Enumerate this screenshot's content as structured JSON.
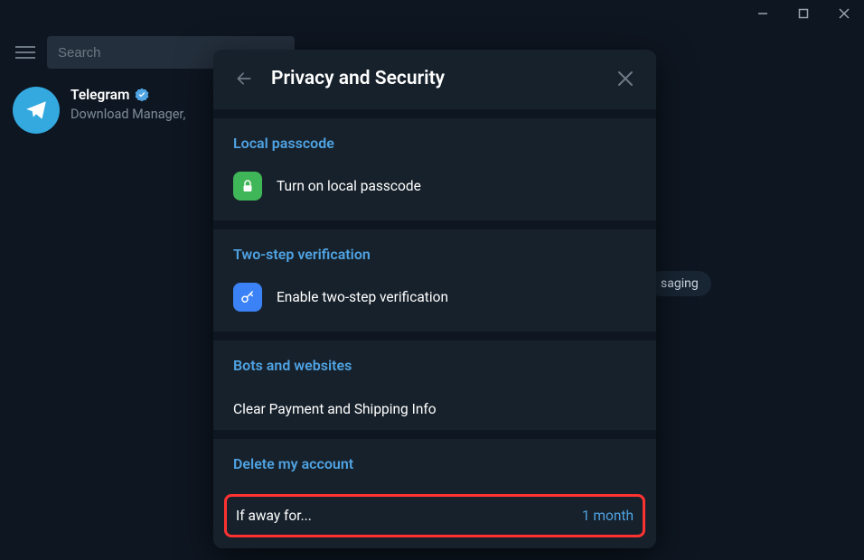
{
  "search": {
    "placeholder": "Search"
  },
  "chat": {
    "title": "Telegram",
    "subtitle": "Download Manager,"
  },
  "bg_badge": "saging",
  "modal": {
    "title": "Privacy and Security",
    "local_passcode": {
      "header": "Local passcode",
      "row_label": "Turn on local passcode"
    },
    "two_step": {
      "header": "Two-step verification",
      "row_label": "Enable two-step verification"
    },
    "bots": {
      "header": "Bots and websites",
      "row_label": "Clear Payment and Shipping Info"
    },
    "delete": {
      "header": "Delete my account",
      "label": "If away for...",
      "value": "1 month"
    }
  }
}
